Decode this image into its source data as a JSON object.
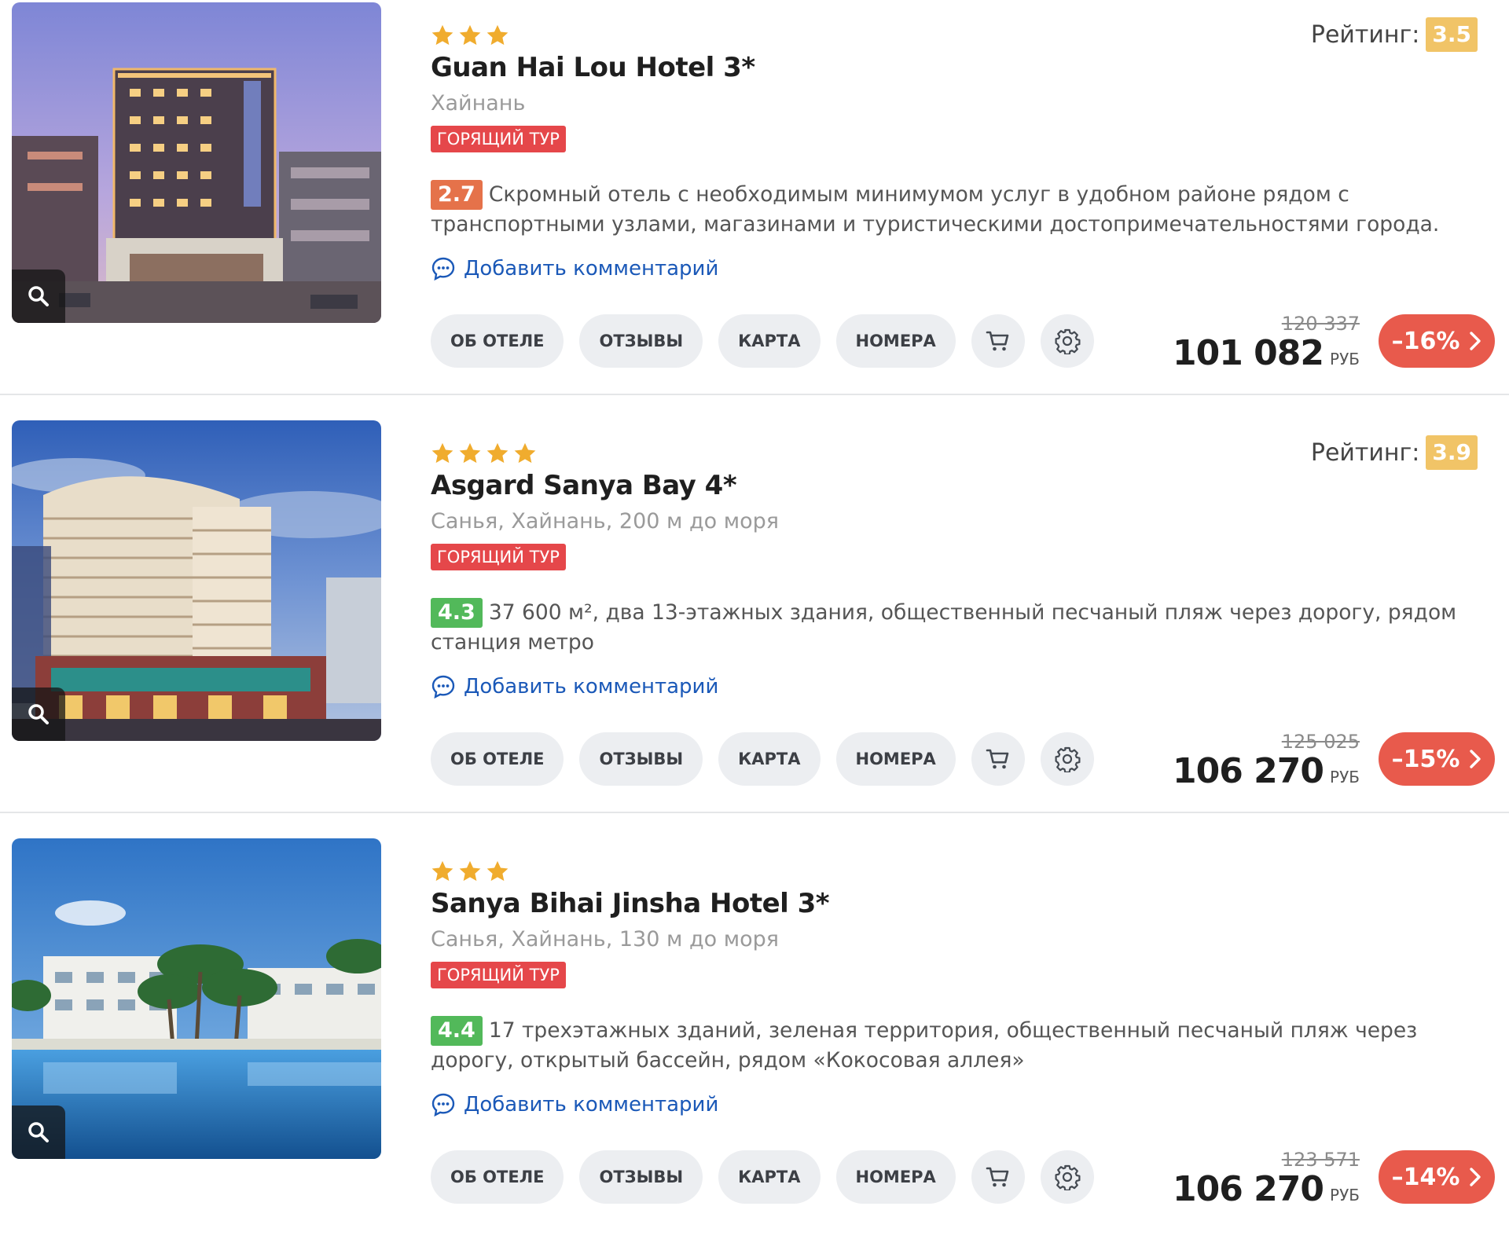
{
  "hotels": [
    {
      "stars": 3,
      "name": "Guan Hai Lou Hotel 3*",
      "location": "Хайнань",
      "hot_label": "ГОРЯЩИЙ ТУР",
      "rating_label": "Рейтинг:",
      "rating": "3.5",
      "review_score": "2.7",
      "review_score_color": "#e5724a",
      "description": "Скромный отель с необходимым минимумом услуг в удобном районе рядом с транспортными узлами, магазинами и туристическими достопримечательностями города.",
      "comment_link": "Добавить комментарий",
      "buttons": {
        "about": "ОБ ОТЕЛЕ",
        "reviews": "ОТЗЫВЫ",
        "map": "КАРТА",
        "rooms": "НОМЕРА"
      },
      "icons": {
        "cart": "cart-icon",
        "settings": "gear-icon",
        "zoom": "search-icon",
        "comment": "comment-icon"
      },
      "old_price": "120 337",
      "price": "101 082",
      "currency": "РУБ",
      "discount": "–16%"
    },
    {
      "stars": 4,
      "name": "Asgard Sanya Bay 4*",
      "location": "Санья, Хайнань, 200 м до моря",
      "hot_label": "ГОРЯЩИЙ ТУР",
      "rating_label": "Рейтинг:",
      "rating": "3.9",
      "review_score": "4.3",
      "review_score_color": "#52b95a",
      "description": "37 600 м², два 13-этажных здания, общественный песчаный пляж через дорогу, рядом станция метро",
      "comment_link": "Добавить комментарий",
      "buttons": {
        "about": "ОБ ОТЕЛЕ",
        "reviews": "ОТЗЫВЫ",
        "map": "КАРТА",
        "rooms": "НОМЕРА"
      },
      "icons": {
        "cart": "cart-icon",
        "settings": "gear-icon",
        "zoom": "search-icon",
        "comment": "comment-icon"
      },
      "old_price": "125 025",
      "price": "106 270",
      "currency": "РУБ",
      "discount": "–15%"
    },
    {
      "stars": 3,
      "name": "Sanya Bihai Jinsha Hotel 3*",
      "location": "Санья, Хайнань, 130 м до моря",
      "hot_label": "ГОРЯЩИЙ ТУР",
      "rating_label": "",
      "rating": "",
      "review_score": "4.4",
      "review_score_color": "#52b95a",
      "description": "17 трехэтажных зданий, зеленая территория, общественный песчаный пляж через дорогу, открытый бассейн, рядом «Кокосовая аллея»",
      "comment_link": "Добавить комментарий",
      "buttons": {
        "about": "ОБ ОТЕЛЕ",
        "reviews": "ОТЗЫВЫ",
        "map": "КАРТА",
        "rooms": "НОМЕРА"
      },
      "icons": {
        "cart": "cart-icon",
        "settings": "gear-icon",
        "zoom": "search-icon",
        "comment": "comment-icon"
      },
      "old_price": "123 571",
      "price": "106 270",
      "currency": "РУБ",
      "discount": "–14%"
    }
  ],
  "colors": {
    "star": "#f0ac2e",
    "hot_badge": "#e5474a",
    "rating_badge": "#f1c467",
    "link": "#1b59b8",
    "discount": "#e85a4c",
    "pill_bg": "#eceef1"
  }
}
